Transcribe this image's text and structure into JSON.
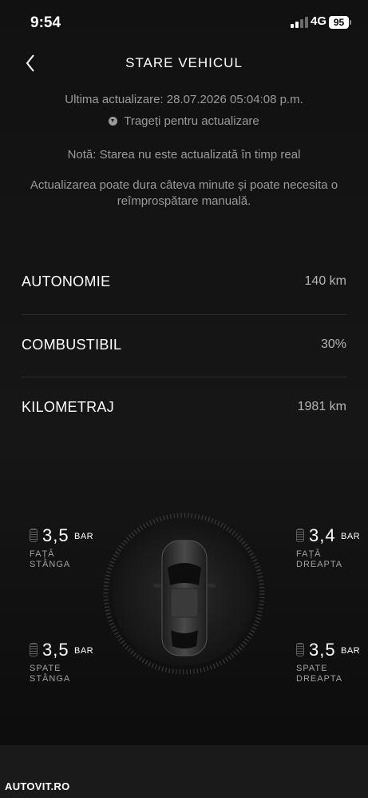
{
  "status_bar": {
    "time": "9:54",
    "network": "4G",
    "battery": "95"
  },
  "header": {
    "title": "STARE VEHICUL"
  },
  "info": {
    "last_update": "Ultima actualizare: 28.07.2026 05:04:08 p.m.",
    "pull_to_refresh": "Trageți pentru actualizare",
    "note": "Notă: Starea nu este actualizată în timp real",
    "refresh_info": "Actualizarea poate dura câteva minute și poate necesita o reîmprospătare manuală."
  },
  "stats": [
    {
      "label": "AUTONOMIE",
      "value": "140 km"
    },
    {
      "label": "COMBUSTIBIL",
      "value": "30%"
    },
    {
      "label": "KILOMETRAJ",
      "value": "1981 km"
    }
  ],
  "tires": {
    "front_left": {
      "value": "3,5",
      "unit": "BAR",
      "label_line1": "FAȚĂ",
      "label_line2": "STÂNGA"
    },
    "front_right": {
      "value": "3,4",
      "unit": "BAR",
      "label_line1": "FAȚĂ",
      "label_line2": "DREAPTA"
    },
    "rear_left": {
      "value": "3,5",
      "unit": "BAR",
      "label_line1": "SPATE",
      "label_line2": "STÂNGA"
    },
    "rear_right": {
      "value": "3,5",
      "unit": "BAR",
      "label_line1": "SPATE",
      "label_line2": "DREAPTA"
    }
  },
  "footer": {
    "watermark": "AUTOVIT.RO"
  }
}
